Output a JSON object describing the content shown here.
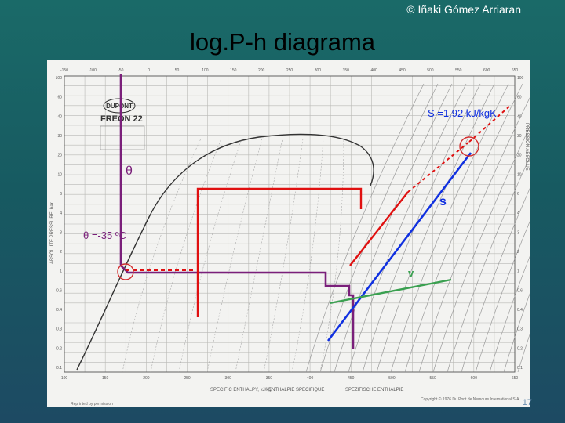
{
  "header": {
    "copyright": "© Iñaki Gómez Arriaran",
    "title": "log.P-h diagrama"
  },
  "chart": {
    "logo_text": "FREON 22",
    "top_axis_ticks": [
      "-150",
      "-100",
      "-50",
      "0",
      "50",
      "100",
      "150",
      "200",
      "250",
      "300",
      "350",
      "400",
      "450",
      "500",
      "550",
      "600",
      "650"
    ],
    "bottom_axis_ticks": [
      "100",
      "150",
      "200",
      "250",
      "300",
      "350",
      "400",
      "450",
      "500",
      "550",
      "600",
      "650"
    ],
    "left_axis_ticks": [
      "100",
      "60",
      "40",
      "30",
      "20",
      "10",
      "6",
      "4",
      "3",
      "2",
      "1",
      "0.6",
      "0.4",
      "0.3",
      "0.2",
      "0.1"
    ],
    "right_axis_ticks": [
      "100",
      "60",
      "40",
      "30",
      "20",
      "10",
      "6",
      "4",
      "3",
      "2",
      "1",
      "0.6",
      "0.4",
      "0.3",
      "0.2",
      "0.1"
    ],
    "bottom_label_left": "SPECIFIC ENTHALPY, kJ/kg",
    "bottom_label_mid": "ENTHALPIE SPECIFIQUE",
    "bottom_label_right": "SPEZIFISCHE ENTHALPIE",
    "left_axis_label": "ABSOLUTE PRESSURE, bar",
    "right_axis_label": "PRESSION ABSOLUE",
    "footer_left": "Reprinted by permission",
    "footer_right": "Copyright © 1976 Du Pont de Nemours International S.A.",
    "theta_label": "θ",
    "theta_value_label": "θ =-35 ºC",
    "entropy_value_label": "S =1,92 kJ/kgK",
    "s_label": "s",
    "v_label": "v"
  },
  "colors": {
    "purple": "#7a1f7a",
    "red": "#e01010",
    "blue": "#1030e0",
    "green": "#3aa050",
    "circle": "#d33030"
  },
  "slide": {
    "number": "17"
  }
}
